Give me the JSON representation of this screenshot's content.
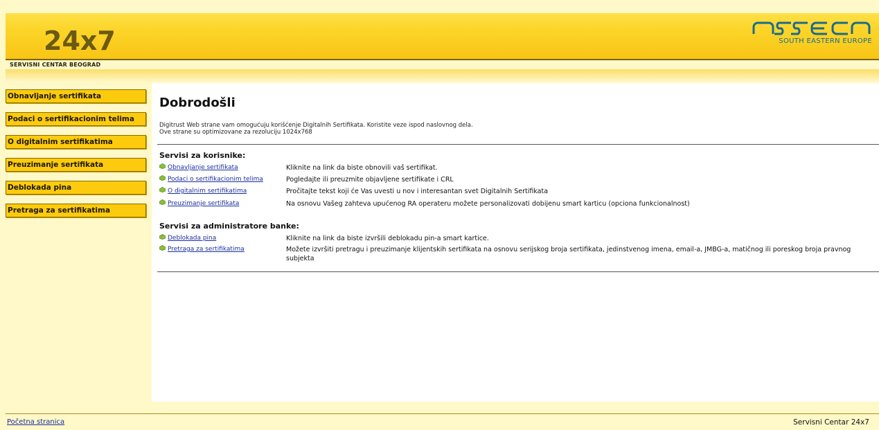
{
  "header": {
    "logo": "24x7",
    "subtitle": "SERVISNI CENTAR BEOGRAD",
    "brand_logo": "asseco",
    "brand_region": "SOUTH EASTERN EUROPE"
  },
  "sidebar": {
    "items": [
      {
        "label": "Obnavljanje sertifikata"
      },
      {
        "label": "Podaci o sertifikacionim telima"
      },
      {
        "label": "O digitalnim sertifikatima"
      },
      {
        "label": "Preuzimanje sertifikata"
      },
      {
        "label": "Deblokada pina"
      },
      {
        "label": "Pretraga za sertifikatima"
      }
    ]
  },
  "main": {
    "title": "Dobrodošli",
    "intro_line1": "Digitrust Web strane vam omogućuju korišćenje Digitalnih Sertifikata. Koristite veze ispod naslovnog dela.",
    "intro_line2": "Ove strane su optimizovane za rezoluciju 1024x768",
    "sections": [
      {
        "title": "Servisi za korisnike:",
        "rows": [
          {
            "link": "Obnavljanje sertifikata",
            "desc": "Kliknite na link da biste obnovili vaš sertifikat."
          },
          {
            "link": "Podaci o sertifikacionim telima",
            "desc": "Pogledajte ili preuzmite objavljene sertifikate i CRL"
          },
          {
            "link": "O digitalnim sertifikatima",
            "desc": "Pročitajte tekst koji će Vas uvesti u nov i interesantan svet Digitalnih Sertifikata"
          },
          {
            "link": "Preuzimanje sertifikata",
            "desc": "Na osnovu Vašeg zahteva upućenog RA operateru možete personalizovati dobijenu smart karticu (opciona funkcionalnost)"
          }
        ]
      },
      {
        "title": "Servisi za administratore banke:",
        "rows": [
          {
            "link": "Deblokada pina",
            "desc": "Kliknite na link da biste izvršili deblokadu pin-a smart kartice."
          },
          {
            "link": "Pretraga za sertifikatima",
            "desc": "Možete izvršiti pretragu i preuzimanje klijentskih sertifikata na osnovu serijskog broja sertifikata, jedinstvenog imena, email-a, JMBG-a, matičnog ili poreskog broja pravnog subjekta"
          }
        ]
      }
    ]
  },
  "footer": {
    "home_link": "Početna stranica",
    "right_text": "Servisni Centar 24x7"
  },
  "colors": {
    "header_yellow": "#fcd52a",
    "nav_button": "#fccb0e",
    "sidebar_bg": "#fff8c8",
    "link_blue": "#1a2ea0",
    "brand_teal": "#1a6b8a"
  }
}
